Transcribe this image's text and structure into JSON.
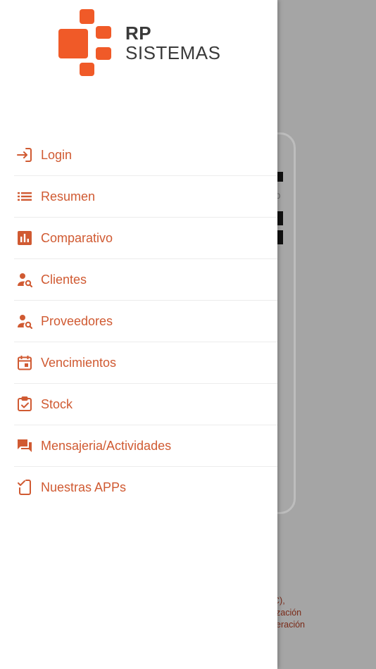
{
  "brand": {
    "line1": "RP",
    "line2": "SISTEMAS",
    "color": "#f05a28",
    "text_color": "#3a3a3a"
  },
  "menu": {
    "accent": "#d05a32",
    "items": [
      {
        "label": "Login",
        "icon": "login-icon"
      },
      {
        "label": "Resumen",
        "icon": "list-icon"
      },
      {
        "label": "Comparativo",
        "icon": "bar-chart-icon"
      },
      {
        "label": "Clientes",
        "icon": "person-search-icon"
      },
      {
        "label": "Proveedores",
        "icon": "person-search-icon"
      },
      {
        "label": "Vencimientos",
        "icon": "calendar-icon"
      },
      {
        "label": "Stock",
        "icon": "clipboard-check-icon"
      },
      {
        "label": "Mensajeria/Actividades",
        "icon": "forum-icon"
      },
      {
        "label": "Nuestras APPs",
        "icon": "mobile-check-icon"
      }
    ]
  },
  "background": {
    "partial_text": [
      "C),",
      "zación",
      "eración"
    ],
    "small_mark": "0"
  }
}
